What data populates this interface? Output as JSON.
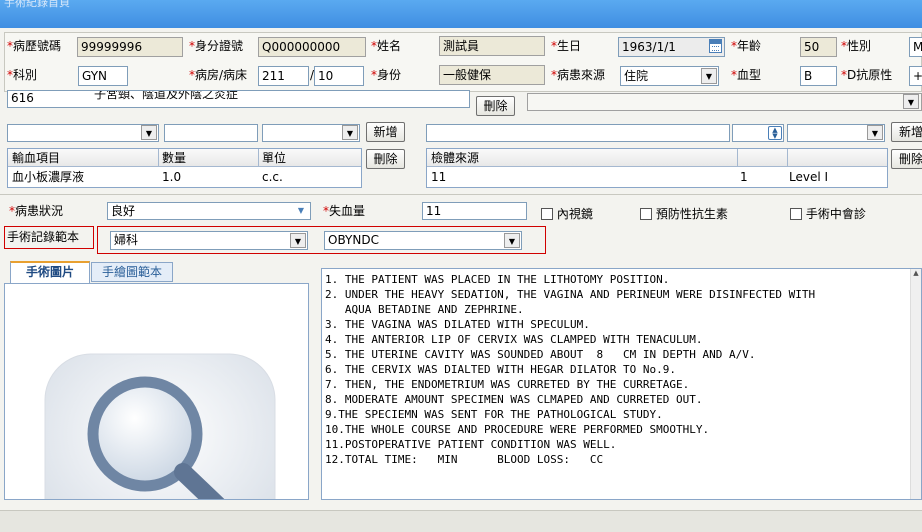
{
  "window": {
    "title": "手術紀錄首頁"
  },
  "patient": {
    "chart_no_label": "病歷號碼",
    "chart_no": "99999996",
    "id_label": "身分證號",
    "id_no": "Q000000000",
    "name_label": "姓名",
    "name": "測試員",
    "birth_label": "生日",
    "birth": "1963/1/1",
    "age_label": "年齡",
    "age": "50",
    "sex_label": "性別",
    "sex": "M",
    "dept_label": "科別",
    "dept": "GYN",
    "ward_label": "病房/病床",
    "ward": "211",
    "bed": "10",
    "ward_sep": "/",
    "identity_label": "身份",
    "identity": "一般健保",
    "source_label": "病患來源",
    "source": "住院",
    "blood_label": "血型",
    "blood": "B",
    "rh_label": "D抗原性",
    "rh": "+"
  },
  "diagnosis": {
    "code": "616",
    "desc": "子宮頸、陰道及外陰之炎症",
    "delete_label": "刪除"
  },
  "transfusion": {
    "add_label": "新增",
    "delete_label": "刪除",
    "headers": [
      "輸血項目",
      "數量",
      "單位"
    ],
    "rows": [
      {
        "item": "血小板濃厚液",
        "qty": "1.0",
        "unit": "c.c."
      }
    ]
  },
  "specimen": {
    "add_label": "新增",
    "delete_label": "刪除",
    "headers": [
      "檢體來源",
      "",
      ""
    ],
    "rows": [
      {
        "source": "11",
        "count": "1",
        "level": "Level I"
      }
    ]
  },
  "status": {
    "condition_label": "病患狀況",
    "condition": "良好",
    "blood_loss_label": "失血量",
    "blood_loss": "11",
    "endoscopy_label": "內視鏡",
    "antibiotic_label": "預防性抗生素",
    "consult_label": "手術中會診"
  },
  "template": {
    "label": "手術記錄範本",
    "category": "婦科",
    "code": "OBYNDC"
  },
  "tabs": [
    {
      "label": "手術圖片",
      "active": true
    },
    {
      "label": "手繪圖範本",
      "active": false
    }
  ],
  "record_text": [
    "1. THE PATIENT WAS PLACED IN THE LITHOTOMY POSITION.",
    "2. UNDER THE HEAVY SEDATION, THE VAGINA AND PERINEUM WERE DISINFECTED WITH",
    "   AQUA BETADINE AND ZEPHRINE.",
    "3. THE VAGINA WAS DILATED WITH SPECULUM.",
    "4. THE ANTERIOR LIP OF CERVIX WAS CLAMPED WITH TENACULUM.",
    "5. THE UTERINE CAVITY WAS SOUNDED ABOUT  8   CM IN DEPTH AND A/V.",
    "6. THE CERVIX WAS DIALTED WITH HEGAR DILATOR TO No.9.",
    "7. THEN, THE ENDOMETRIUM WAS CURRETED BY THE CURRETAGE.",
    "8. MODERATE AMOUNT SPECIMEN WAS CLMAPED AND CURRETED OUT.",
    "9.THE SPECIEMN WAS SENT FOR THE PATHOLOGICAL STUDY.",
    "10.THE WHOLE COURSE AND PROCEDURE WERE PERFORMED SMOOTHLY.",
    "11.POSTOPERATIVE PATIENT CONDITION WAS WELL.",
    "12.TOTAL TIME:   MIN      BLOOD LOSS:   CC"
  ],
  "colors": {
    "accent": "#3f8ee2",
    "required": "#d00000",
    "highlight": "#d00000"
  },
  "icons": {
    "calendar": "calendar-icon",
    "magnifier": "magnifier-icon"
  }
}
